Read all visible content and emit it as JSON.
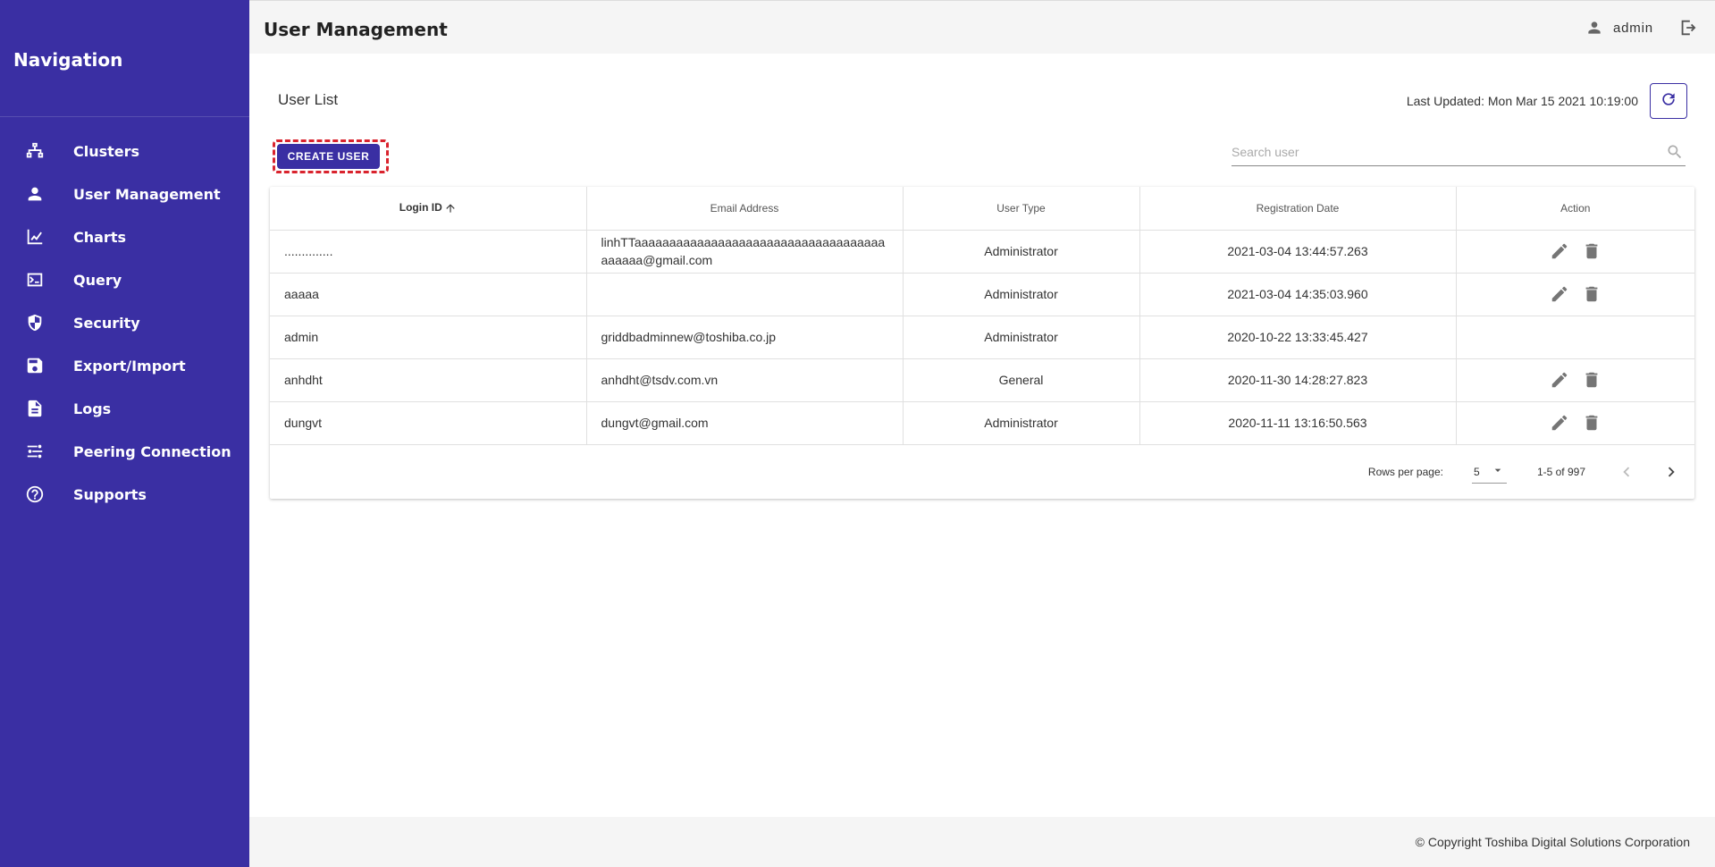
{
  "sidebar": {
    "title": "Navigation",
    "items": [
      {
        "label": "Clusters",
        "icon": "cluster-icon"
      },
      {
        "label": "User Management",
        "icon": "person-icon"
      },
      {
        "label": "Charts",
        "icon": "line-chart-icon"
      },
      {
        "label": "Query",
        "icon": "terminal-icon"
      },
      {
        "label": "Security",
        "icon": "shield-icon"
      },
      {
        "label": "Export/Import",
        "icon": "save-icon"
      },
      {
        "label": "Logs",
        "icon": "document-icon"
      },
      {
        "label": "Peering Connection",
        "icon": "peering-icon"
      },
      {
        "label": "Supports",
        "icon": "help-icon"
      }
    ],
    "background": "#3a2fa3"
  },
  "header": {
    "title": "User Management",
    "username": "admin"
  },
  "main": {
    "section_title": "User List",
    "last_updated": "Last Updated: Mon Mar 15 2021 10:19:00",
    "create_button": "CREATE USER",
    "search_placeholder": "Search user",
    "columns": [
      "Login ID",
      "Email Address",
      "User Type",
      "Registration Date",
      "Action"
    ],
    "rows": [
      {
        "login": "..............",
        "email": "linhTTaaaaaaaaaaaaaaaaaaaaaaaaaaaaaaaaaaaaaaaaaa@gmail.com",
        "type": "Administrator",
        "date": "2021-03-04 13:44:57.263",
        "actions": true
      },
      {
        "login": "aaaaa",
        "email": "",
        "type": "Administrator",
        "date": "2021-03-04 14:35:03.960",
        "actions": true
      },
      {
        "login": "admin",
        "email": "griddbadminnew@toshiba.co.jp",
        "type": "Administrator",
        "date": "2020-10-22 13:33:45.427",
        "actions": false
      },
      {
        "login": "anhdht",
        "email": "anhdht@tsdv.com.vn",
        "type": "General",
        "date": "2020-11-30 14:28:27.823",
        "actions": true
      },
      {
        "login": "dungvt",
        "email": "dungvt@gmail.com",
        "type": "Administrator",
        "date": "2020-11-11 13:16:50.563",
        "actions": true
      }
    ],
    "pagination": {
      "rows_per_page_label": "Rows per page:",
      "rows_per_page": "5",
      "range": "1-5 of 997"
    }
  },
  "footer": {
    "copyright": "© Copyright Toshiba Digital Solutions Corporation"
  },
  "accent_color": "#3a2fa3",
  "highlight_color": "#d9232d"
}
